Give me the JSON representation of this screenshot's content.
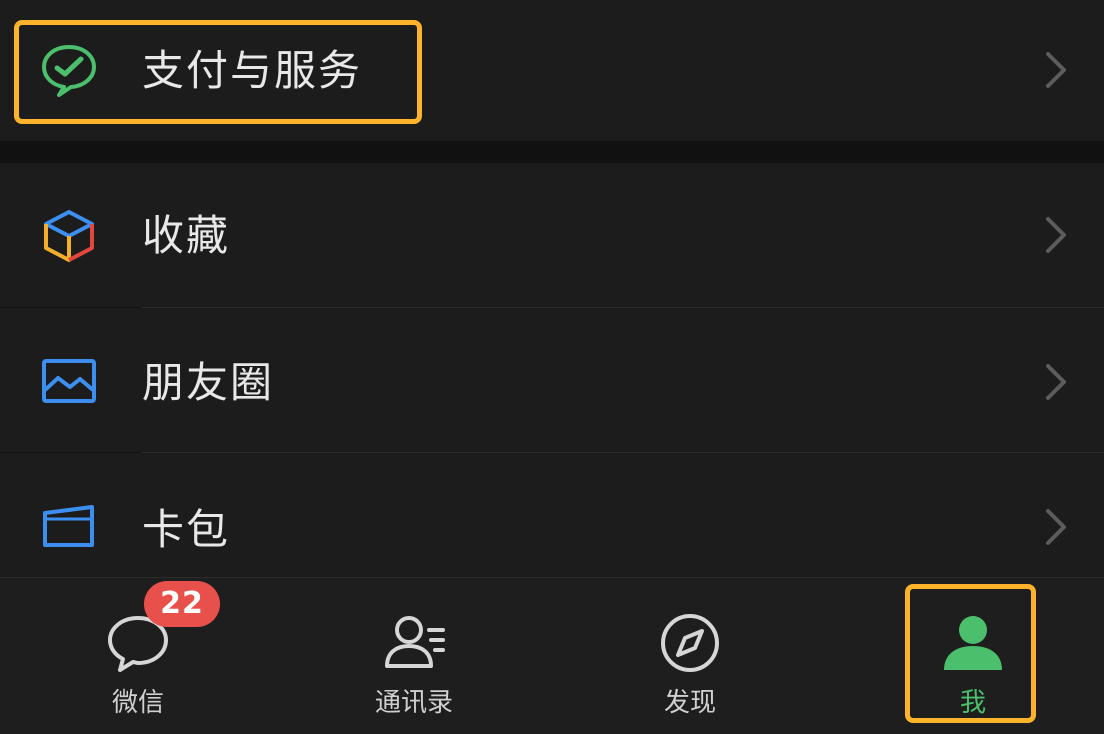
{
  "menu": {
    "pay": {
      "label": "支付与服务",
      "icon": "wechat-pay-icon"
    },
    "favorites": {
      "label": "收藏",
      "icon": "favorites-cube-icon"
    },
    "moments": {
      "label": "朋友圈",
      "icon": "moments-photo-icon"
    },
    "cards": {
      "label": "卡包",
      "icon": "card-wallet-icon"
    }
  },
  "tabs": {
    "chats": {
      "label": "微信",
      "badge": "22",
      "icon": "chat-bubble-icon"
    },
    "contacts": {
      "label": "通讯录",
      "icon": "contacts-person-icon"
    },
    "discover": {
      "label": "发现",
      "icon": "compass-icon"
    },
    "me": {
      "label": "我",
      "icon": "me-person-icon",
      "active": true
    }
  },
  "colors": {
    "background": "#111111",
    "row": "#1c1c1c",
    "accent_green": "#4cbf6c",
    "highlight": "#ffb32b",
    "badge": "#e8504c",
    "text": "#e8e8e8"
  }
}
